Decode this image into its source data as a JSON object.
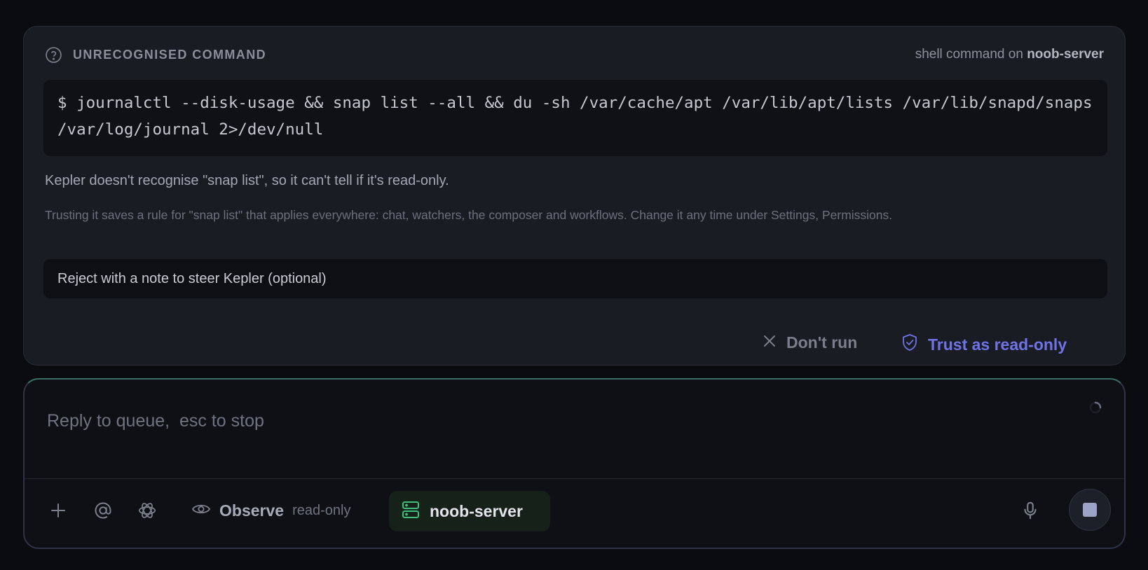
{
  "approval": {
    "title": "UNRECOGNISED COMMAND",
    "context_prefix": "shell command on",
    "server": "noob-server",
    "command": "$ journalctl --disk-usage && snap list --all && du -sh /var/cache/apt /var/lib/apt/lists /var/lib/snapd/snaps /var/log/journal 2>/dev/null",
    "message": "Kepler doesn't recognise \"snap list\", so it can't tell if it's read-only.",
    "detail": "Trusting it saves a rule for \"snap list\" that applies everywhere: chat, watchers, the composer and workflows. Change it any time under Settings, Permissions.",
    "note_placeholder": "Reject with a note to steer Kepler (optional)",
    "reject_label": "Don't run",
    "trust_label": "Trust as read-only"
  },
  "composer": {
    "placeholder": "Reply to queue,  esc to stop",
    "mode_label": "Observe",
    "mode_desc": "read-only",
    "server": "noob-server"
  },
  "icons": {
    "help": "question-circle-icon",
    "reject": "x-icon",
    "trust": "shield-check-icon",
    "add": "plus-icon",
    "mention": "at-icon",
    "model": "openai-icon",
    "observe": "eye-icon",
    "server": "server-icon",
    "mic": "microphone-icon",
    "stop": "stop-icon",
    "spinner": "loading-spinner-icon"
  },
  "colors": {
    "accent": "#6f73e6",
    "server_green": "#3fbf7f",
    "background": "#0b0c10",
    "card": "#1a1c24"
  }
}
